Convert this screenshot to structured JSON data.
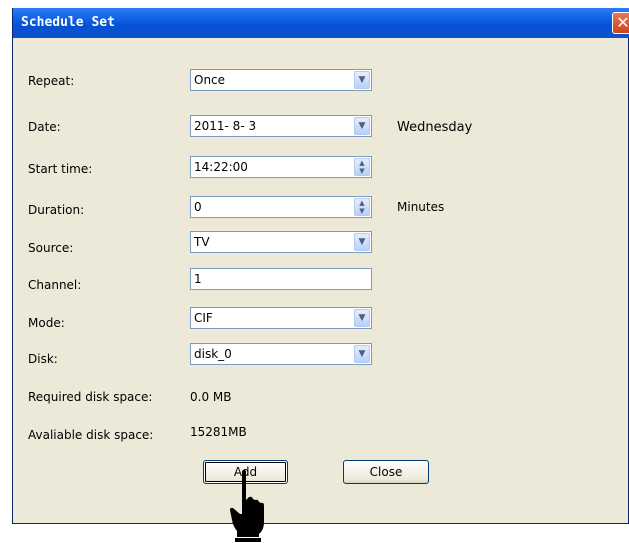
{
  "window": {
    "title": "Schedule Set",
    "close_glyph": "✕"
  },
  "form": {
    "repeat_label": "Repeat:",
    "repeat_value": "Once",
    "date_label": "Date:",
    "date_value": "2011- 8- 3",
    "date_weekday": "Wednesday",
    "start_label": "Start time:",
    "start_value": "14:22:00",
    "duration_label": "Duration:",
    "duration_value": "0",
    "duration_unit": "Minutes",
    "source_label": "Source:",
    "source_value": "TV",
    "channel_label": "Channel:",
    "channel_value": "1",
    "mode_label": "Mode:",
    "mode_value": "CIF",
    "disk_label": "Disk:",
    "disk_value": "disk_0",
    "required_label": "Required disk space:",
    "required_value": "0.0 MB",
    "available_label": "Avaliable disk space:",
    "available_value": "15281MB"
  },
  "buttons": {
    "add": "Add",
    "close": "Close"
  },
  "icons": {
    "dropdown": "chevron-down-icon",
    "spinner": "spinner-icon",
    "pointer": "hand-pointer-icon"
  },
  "colors": {
    "titlebar": "#0a5be0",
    "dialog_bg": "#ece9d8",
    "close_button": "#c9431d"
  }
}
